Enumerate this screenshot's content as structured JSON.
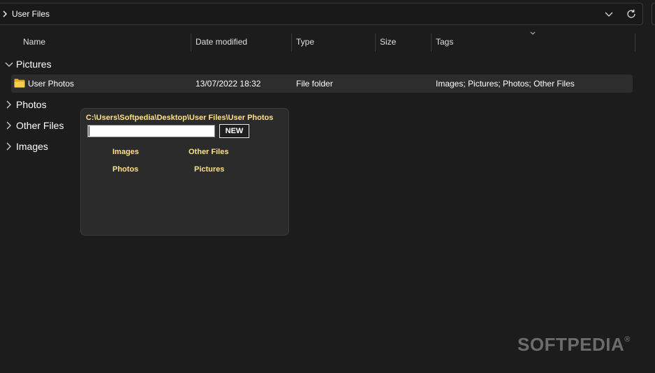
{
  "address_bar": {
    "path": "User Files"
  },
  "columns": {
    "name": "Name",
    "date_modified": "Date modified",
    "type": "Type",
    "size": "Size",
    "tags": "Tags"
  },
  "groups": [
    {
      "label": "Pictures",
      "expanded": true
    },
    {
      "label": "Photos",
      "expanded": false
    },
    {
      "label": "Other Files",
      "expanded": false
    },
    {
      "label": "Images",
      "expanded": false
    }
  ],
  "rows": [
    {
      "name": "User Photos",
      "date_modified": "13/07/2022 18:32",
      "type": "File folder",
      "size": "",
      "tags": "Images; Pictures; Photos; Other Files"
    }
  ],
  "popup": {
    "path": "C:\\Users\\Softpedia\\Desktop\\User Files\\User Photos",
    "input_value": "",
    "new_button": "NEW",
    "tags": [
      "Images",
      "Other Files",
      "Photos",
      "Pictures"
    ]
  },
  "watermark": {
    "text": "SOFTPEDIA",
    "mark": "®"
  },
  "colors": {
    "background": "#1c1c1c",
    "popup_bg": "#2b2b2b",
    "accent_text": "#ffe08a",
    "folder": "#f4c430",
    "selected_row": "#2d2d2d"
  },
  "icons": [
    "chevron-right-icon",
    "chevron-down-icon",
    "refresh-icon",
    "folder-icon",
    "sort-caret-icon"
  ]
}
